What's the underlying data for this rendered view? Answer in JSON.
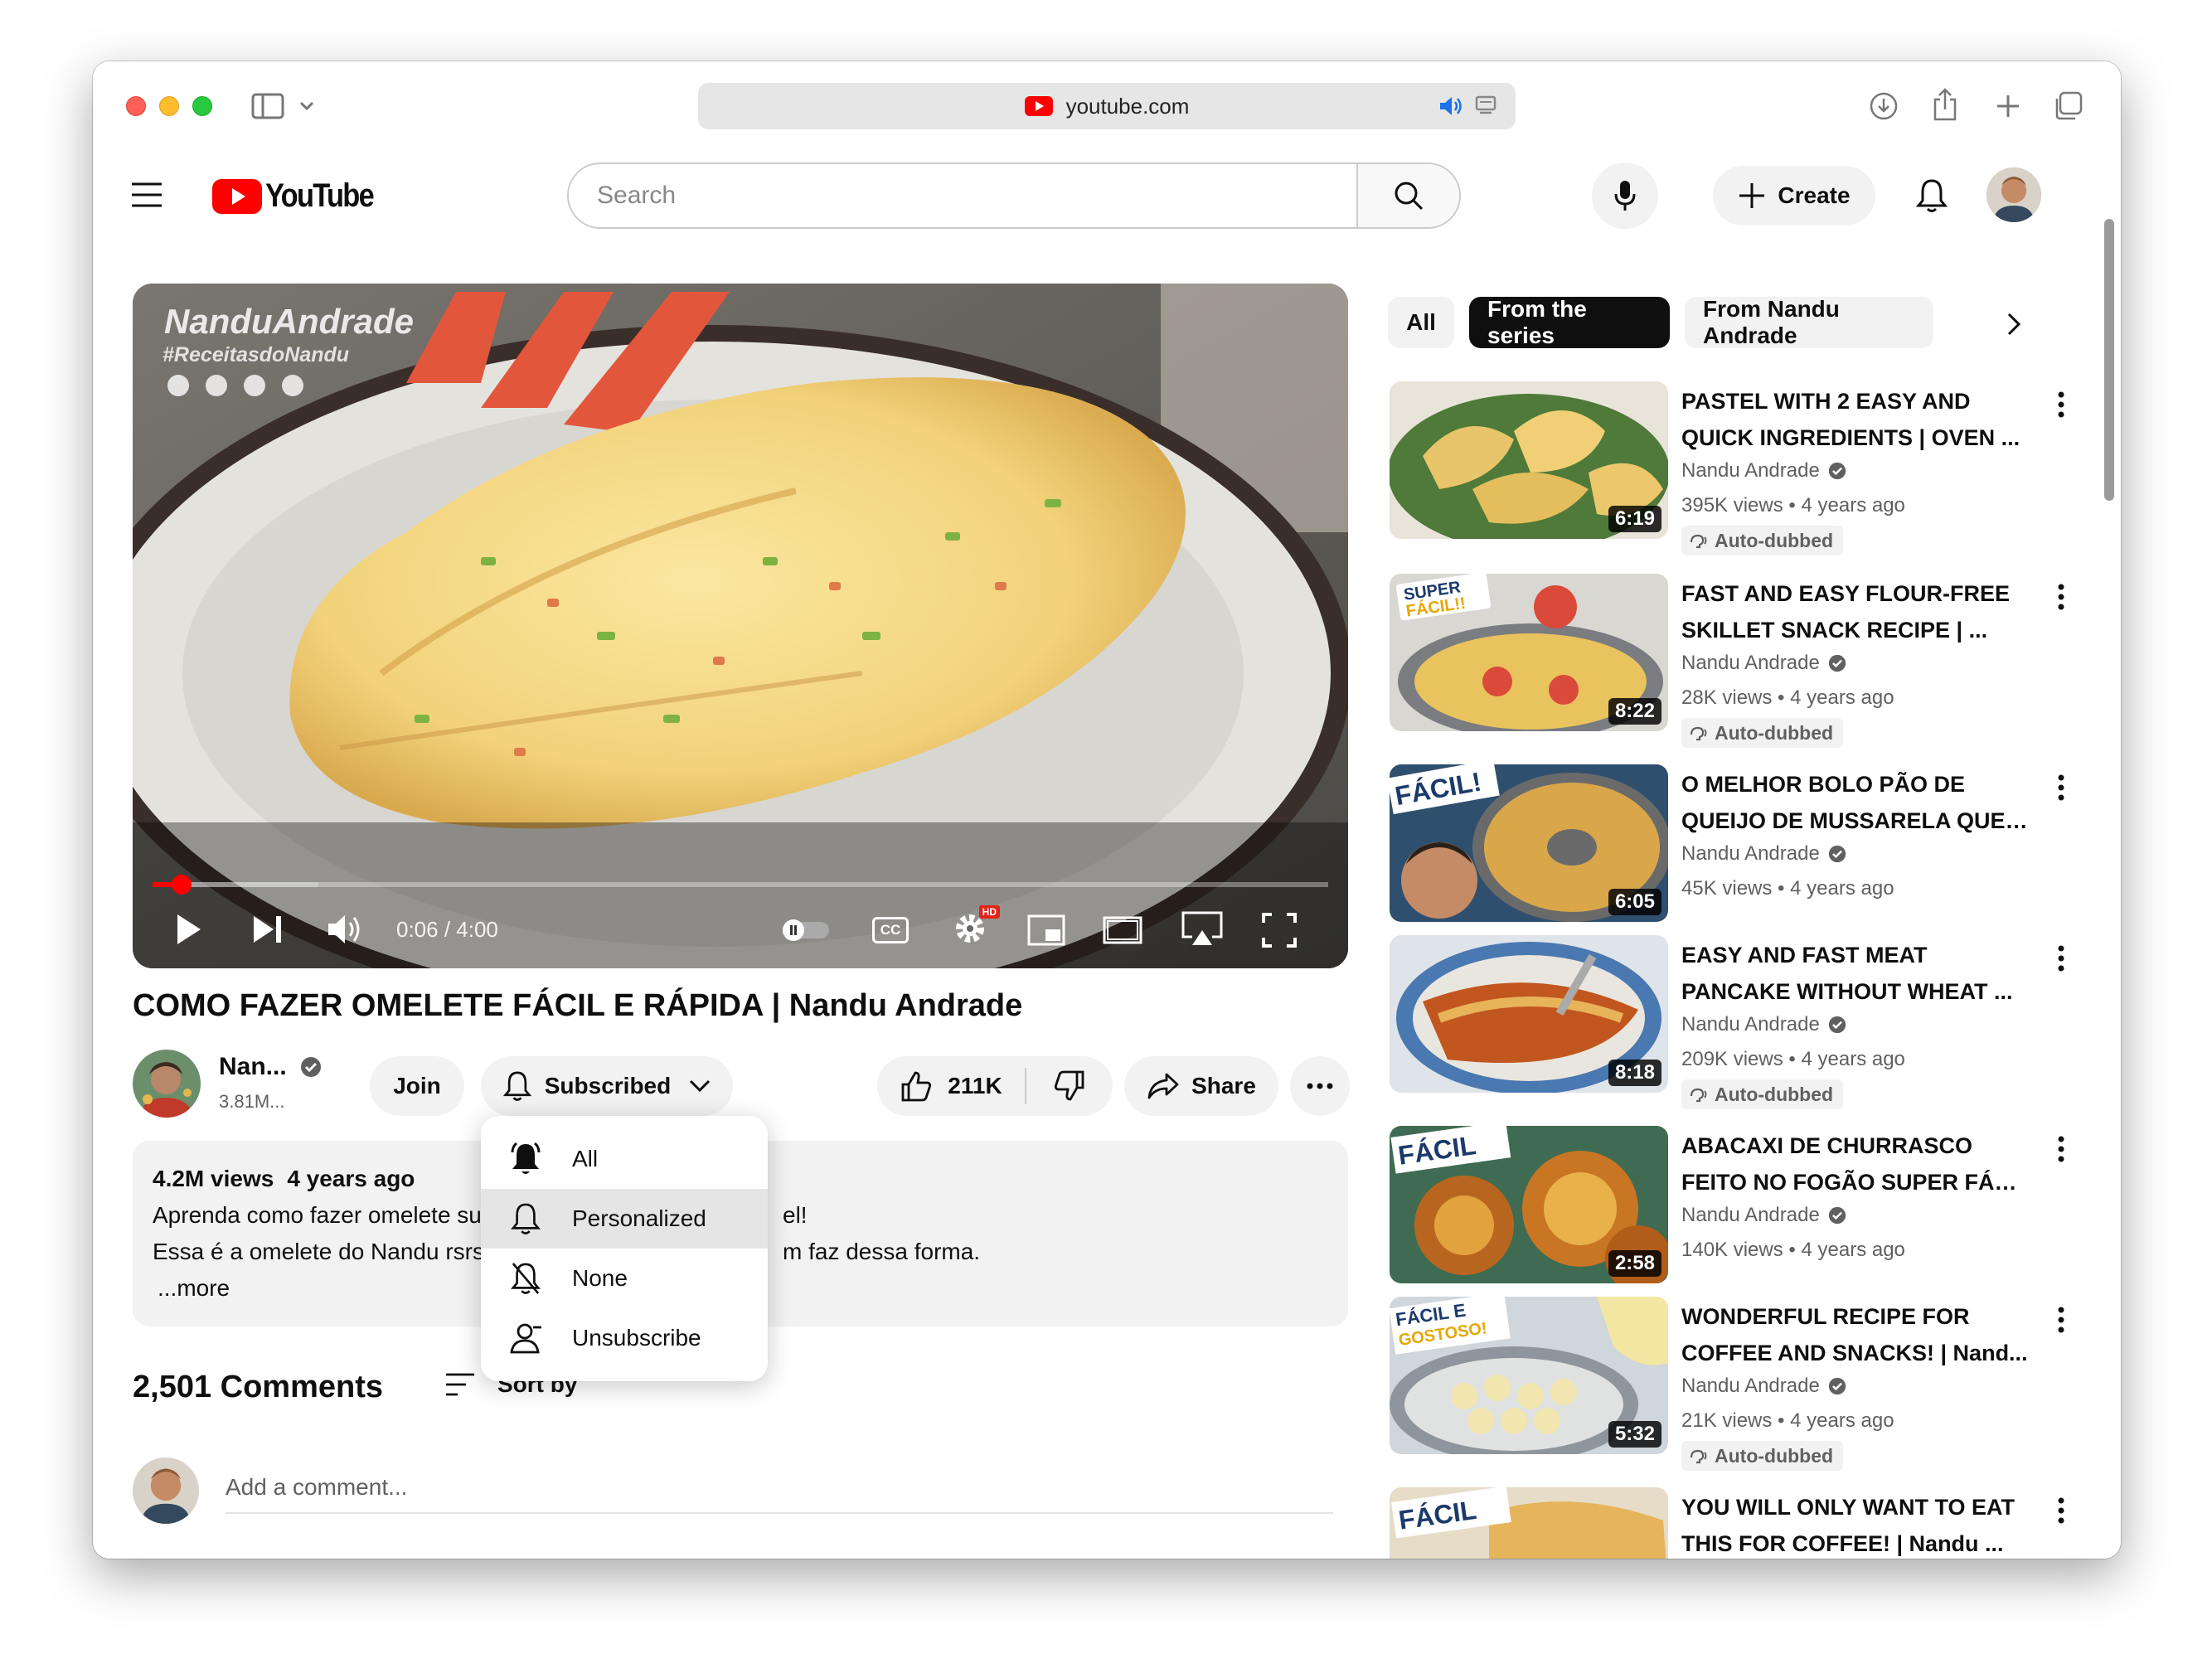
{
  "browser": {
    "url": "youtube.com",
    "icons": [
      "sidebar-icon",
      "chevron-down-icon",
      "speaker-icon",
      "reader-icon",
      "download-icon",
      "share-icon",
      "new-tab-icon",
      "tabs-icon"
    ]
  },
  "header": {
    "logo_text": "YouTube",
    "search_placeholder": "Search",
    "create_label": "Create"
  },
  "player": {
    "overlay_name": "NanduAndrade",
    "overlay_tag": "#ReceitasdoNandu",
    "time": "0:06 / 4:00",
    "progress": 0.025,
    "hd_badge": "HD",
    "cc_label": "CC"
  },
  "video": {
    "title": "COMO FAZER OMELETE FÁCIL E RÁPIDA | Nandu Andrade",
    "channel_name": "Nan...",
    "subscribers": "3.81M...",
    "join_label": "Join",
    "subscribed_label": "Subscribed",
    "likes": "211K",
    "share_label": "Share"
  },
  "description": {
    "views": "4.2M views",
    "age": "4 years ago",
    "line1_start": "Aprenda como fazer omelete su",
    "line1_end": "el!",
    "line2_start": "Essa é a omelete do Nandu rsrs",
    "line2_end": "m faz dessa forma.",
    "more": "...more"
  },
  "notif_menu": {
    "items": [
      {
        "label": "All",
        "icon": "bell-filled-icon"
      },
      {
        "label": "Personalized",
        "icon": "bell-icon",
        "active": true
      },
      {
        "label": "None",
        "icon": "bell-off-icon"
      },
      {
        "label": "Unsubscribe",
        "icon": "person-remove-icon"
      }
    ]
  },
  "comments": {
    "count": "2,501 Comments",
    "sort_label": "Sort by",
    "placeholder": "Add a comment..."
  },
  "chips": [
    "All",
    "From the series",
    "From Nandu Andrade"
  ],
  "recommendations": [
    {
      "title1": "PASTEL WITH 2 EASY AND",
      "title2": "QUICK INGREDIENTS | OVEN ...",
      "channel": "Nandu Andrade",
      "views": "395K views",
      "age": "4 years ago",
      "duration": "6:19",
      "dubbed": "Auto-dubbed",
      "badge": ""
    },
    {
      "title1": "FAST AND EASY FLOUR-FREE",
      "title2": "SKILLET SNACK RECIPE | ...",
      "channel": "Nandu Andrade",
      "views": "28K views",
      "age": "4 years ago",
      "duration": "8:22",
      "dubbed": "Auto-dubbed",
      "badge": "SUPER FÁCIL!!"
    },
    {
      "title1": "O MELHOR BOLO PÃO DE",
      "title2": "QUEIJO DE MUSSARELA QUE ...",
      "channel": "Nandu Andrade",
      "views": "45K views",
      "age": "4 years ago",
      "duration": "6:05",
      "dubbed": "",
      "badge": "FÁCIL!"
    },
    {
      "title1": "EASY AND FAST MEAT",
      "title2": "PANCAKE WITHOUT WHEAT ...",
      "channel": "Nandu Andrade",
      "views": "209K views",
      "age": "4 years ago",
      "duration": "8:18",
      "dubbed": "Auto-dubbed",
      "badge": ""
    },
    {
      "title1": "ABACAXI DE CHURRASCO",
      "title2": "FEITO NO FOGÃO SUPER FÁCI...",
      "channel": "Nandu Andrade",
      "views": "140K views",
      "age": "4 years ago",
      "duration": "2:58",
      "dubbed": "",
      "badge": "FÁCIL"
    },
    {
      "title1": "WONDERFUL RECIPE FOR",
      "title2": "COFFEE AND SNACKS! | Nand...",
      "channel": "Nandu Andrade",
      "views": "21K views",
      "age": "4 years ago",
      "duration": "5:32",
      "dubbed": "Auto-dubbed",
      "badge": "FÁCIL E GOSTOSO!"
    },
    {
      "title1": "YOU WILL ONLY WANT TO EAT",
      "title2": "THIS FOR COFFEE! | Nandu ...",
      "channel": "",
      "views": "",
      "age": "",
      "duration": "",
      "dubbed": "",
      "badge": "FÁCIL"
    }
  ],
  "colors": {
    "brand_red": "#ff0000",
    "text": "#0f0f0f",
    "muted": "#606060",
    "chip_bg": "#f2f2f2"
  }
}
